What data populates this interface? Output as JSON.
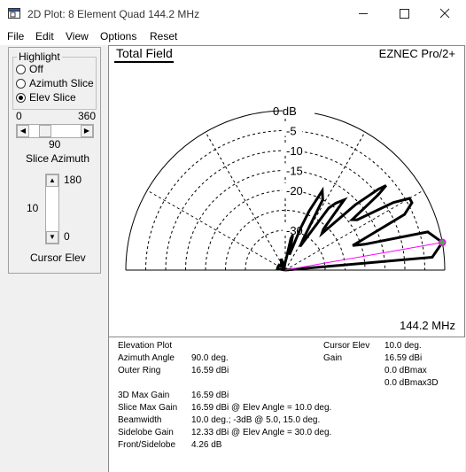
{
  "window": {
    "title": "2D Plot: 8 Element Quad 144.2 MHz",
    "icon": "plot-window-icon",
    "buttons": [
      "minimize-icon",
      "maximize-icon",
      "close-icon"
    ]
  },
  "menu": {
    "items": [
      "File",
      "Edit",
      "View",
      "Options",
      "Reset"
    ]
  },
  "highlight": {
    "group_label": "Highlight",
    "options": [
      "Off",
      "Azimuth Slice",
      "Elev Slice"
    ],
    "selected": "Elev Slice"
  },
  "slice_azimuth": {
    "min_label": "0",
    "max_label": "360",
    "value_label": "90",
    "caption": "Slice Azimuth",
    "value": 90,
    "max": 360
  },
  "cursor_elev": {
    "value_label": "10",
    "top_label": "180",
    "bottom_label": "0",
    "caption": "Cursor Elev"
  },
  "plot": {
    "header": "Total Field",
    "brand": "EZNEC Pro/2+",
    "frequency": "144.2 MHz",
    "ring_labels": [
      "0 dB",
      "-5",
      "-10",
      "-15",
      "-20",
      "-30"
    ],
    "colors": {
      "pattern": "#000000",
      "grid": "#000000",
      "cursor": "#ff00ff",
      "marker": "#3cb43c"
    }
  },
  "chart_data": {
    "type": "polar",
    "angle_unit": "deg (elevation)",
    "radial_unit": "dB",
    "radial_range": [
      -40,
      0
    ],
    "ring_values": [
      0,
      -5,
      -10,
      -15,
      -20,
      -30
    ],
    "series": [
      {
        "angles": [
          0,
          5,
          10,
          15,
          18,
          20,
          22,
          25,
          28,
          30,
          32,
          35,
          37,
          39,
          40,
          41,
          43,
          45,
          47,
          50,
          53,
          55,
          58,
          60,
          62,
          65,
          68,
          70,
          72,
          75,
          78,
          80,
          85,
          90,
          100,
          110,
          120,
          130,
          140,
          150,
          160,
          170,
          180
        ],
        "values": [
          -40,
          -3,
          0,
          -3,
          -19,
          -22,
          -18,
          -7,
          -4,
          -4,
          -8,
          -18,
          -19,
          -10,
          -7,
          -9,
          -16,
          -27,
          -26,
          -17,
          -19,
          -21,
          -33,
          -31,
          -20,
          -18,
          -24,
          -29,
          -34,
          -36,
          -31,
          -32,
          -37,
          -38,
          -39,
          -37,
          -38,
          -39,
          -38,
          -38,
          -38,
          -38,
          -40
        ]
      }
    ],
    "cursor_angle": 10
  },
  "info": {
    "plot_type": "Elevation Plot",
    "azimuth_angle_label": "Azimuth Angle",
    "azimuth_angle_value": "90.0 deg.",
    "outer_ring_label": "Outer Ring",
    "outer_ring_value": "16.59 dBi",
    "max_gain_label": "3D Max Gain",
    "max_gain_value": "16.59 dBi",
    "slice_max_label": "Slice Max Gain",
    "slice_max_value": "16.59 dBi @ Elev Angle = 10.0 deg.",
    "beamwidth_label": "Beamwidth",
    "beamwidth_value": "10.0 deg.; -3dB @ 5.0, 15.0 deg.",
    "sidelobe_label": "Sidelobe Gain",
    "sidelobe_value": "12.33 dBi @ Elev Angle = 30.0 deg.",
    "front_side_label": "Front/Sidelobe",
    "front_side_value": "4.26 dB",
    "cursor_elev_label": "Cursor Elev",
    "cursor_elev_value": "10.0 deg.",
    "gain_label": "Gain",
    "gain_value": "16.59 dBi",
    "dbmax_value": "0.0 dBmax",
    "dbmax3d_value": "0.0 dBmax3D"
  }
}
